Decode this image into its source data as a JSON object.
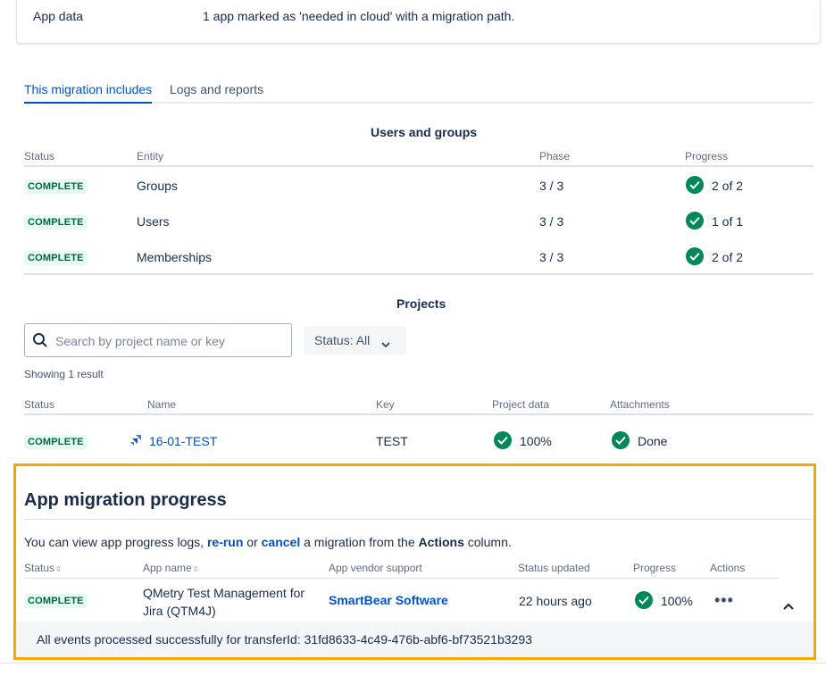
{
  "app_data": {
    "label": "App data",
    "value": "1 app marked as 'needed in cloud' with a migration path."
  },
  "tabs": [
    {
      "label": "This migration includes"
    },
    {
      "label": "Logs and reports"
    }
  ],
  "users_groups": {
    "title": "Users and groups",
    "headers": [
      "Status",
      "Entity",
      "Phase",
      "Progress"
    ],
    "rows": [
      {
        "status": "COMPLETE",
        "entity": "Groups",
        "phase": "3 / 3",
        "progress": "2 of 2"
      },
      {
        "status": "COMPLETE",
        "entity": "Users",
        "phase": "3 / 3",
        "progress": "1 of 1"
      },
      {
        "status": "COMPLETE",
        "entity": "Memberships",
        "phase": "3 / 3",
        "progress": "2 of 2"
      }
    ]
  },
  "projects": {
    "title": "Projects",
    "search_placeholder": "Search by project name or key",
    "status_filter": "Status: All",
    "result_count": "Showing 1 result",
    "headers": [
      "Status",
      "Name",
      "Key",
      "Project data",
      "Attachments"
    ],
    "rows": [
      {
        "status": "COMPLETE",
        "name": "16-01-TEST",
        "key": "TEST",
        "project_data": "100%",
        "attachments": "Done"
      }
    ]
  },
  "app_migration": {
    "title": "App migration progress",
    "desc_prefix": "You can view app progress logs, ",
    "rerun": "re-run",
    "or": " or ",
    "cancel": "cancel",
    "desc_mid": " a migration from the ",
    "actions_word": "Actions",
    "desc_suffix": " column.",
    "headers": {
      "status": "Status",
      "app_name": "App name",
      "vendor": "App vendor support",
      "updated": "Status updated",
      "progress": "Progress",
      "actions": "Actions"
    },
    "row": {
      "status": "COMPLETE",
      "app_name": "QMetry Test Management for Jira (QTM4J)",
      "vendor": "SmartBear Software",
      "updated": "22 hours ago",
      "progress": "100%",
      "more": "•••"
    },
    "event_text": "All events processed successfully for transferId: 31fd8633-4c49-476b-abf6-bf73521b3293"
  },
  "colors": {
    "accent": "#0052cc",
    "success": "#00875a",
    "lozenge_bg": "#e3fcef",
    "highlight": "#f5a800"
  }
}
